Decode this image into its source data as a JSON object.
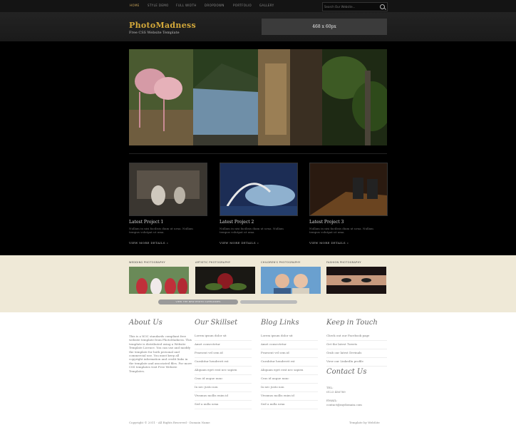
{
  "nav": {
    "items": [
      {
        "label": "HOME"
      },
      {
        "label": "STYLE DEMO"
      },
      {
        "label": "FULL WIDTH"
      },
      {
        "label": "DROPDOWN"
      },
      {
        "label": "PORTFOLIO"
      },
      {
        "label": "GALLERY"
      }
    ],
    "search_placeholder": "Search Our Website..."
  },
  "header": {
    "logo": "PhotoMadness",
    "tagline": "Free CSS Website Template",
    "ad_label": "468 x 60px"
  },
  "projects": [
    {
      "title": "Latest Project 1",
      "text": "Nullam in nisi facilisis diam ut urna. Nullam tempus volutpat ut uma.",
      "more": "VIEW MORE DETAILS »"
    },
    {
      "title": "Latest Project 2",
      "text": "Nullam in nisi facilisis diam ut urna. Nullam tempus volutpat ut uma.",
      "more": "VIEW MORE DETAILS »"
    },
    {
      "title": "Latest Project 3",
      "text": "Nullam in nisi facilisis diam ut urna. Nullam tempus volutpat ut uma.",
      "more": "VIEW MORE DETAILS »"
    }
  ],
  "categories": [
    {
      "label": "WEDDING PHOTOGRAPHY"
    },
    {
      "label": "ARTISTIC PHOTOGRAPHY"
    },
    {
      "label": "CHILDREN'S PHOTOGRAPHY"
    },
    {
      "label": "FASHION PHOTOGRAPHY"
    }
  ],
  "view_more_btn": "VIEW THE NEW PHOTO CATEGORIES",
  "footer": {
    "about_title": "About Us",
    "about_text": "This is a W3C standards compliant free website template from PhotoMadness. This template is distributed using a Website Template Licence. You can use and modify the template for both personal and commercial use. You must keep all copyright information and credit links in the template and associated files. For more CSS templates visit Free Website Templates.",
    "skillset_title": "Our Skillset",
    "skillset_items": [
      "Lorem ipsum dolor sit",
      "Amet consectetur",
      "Praesent vel sem id",
      "Curabitur hendrerit est",
      "Aliquam eget erat nec sapien",
      "Cras id augue nunc",
      "In nec justo non",
      "Vivamus mollis enim id",
      "Sed a nulla urna"
    ],
    "blog_title": "Blog Links",
    "blog_items": [
      "Lorem ipsum dolor sit",
      "Amet consectetur",
      "Praesent vel sem id",
      "Curabitur hendrerit est",
      "Aliquam eget erat nec sapien",
      "Cras id augue nunc",
      "In nec justo non",
      "Vivamus mollis enim id",
      "Sed a nulla urna"
    ],
    "keep_title": "Keep in Touch",
    "keep_items": [
      "Check out our Facebook page",
      "Get the latest Tweets",
      "Grab our latest Devinals",
      "View our LinkedIn profile"
    ],
    "contact_title": "Contact Us",
    "tel_label": "TEL:",
    "tel_value": "0123 456789",
    "email_label": "EMAIL:",
    "email_value": "contact@mydomain.com",
    "copyright": "Copyright © 2011 - All Rights Reserved - Domain Name",
    "template_by": "Template by WebSite"
  }
}
